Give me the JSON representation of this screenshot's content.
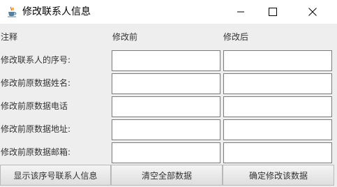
{
  "window": {
    "title": "修改联系人信息",
    "icon": "java-coffee-icon",
    "controls": [
      "minimize-icon",
      "maximize-icon",
      "close-icon"
    ]
  },
  "headers": {
    "note": "注释",
    "before": "修改前",
    "after": "修改后"
  },
  "rows": [
    {
      "label": "修改联系人的序号:",
      "before_value": "",
      "after_value": ""
    },
    {
      "label": "修改前原数据姓名:",
      "before_value": "",
      "after_value": ""
    },
    {
      "label": "修改前原数据电话",
      "before_value": "",
      "after_value": ""
    },
    {
      "label": "修改前原数据地址:",
      "before_value": "",
      "after_value": ""
    },
    {
      "label": "修改前原数据邮箱:",
      "before_value": "",
      "after_value": ""
    }
  ],
  "buttons": {
    "show": "显示该序号联系人信息",
    "clear": "清空全部数据",
    "confirm": "确定修改该数据"
  }
}
